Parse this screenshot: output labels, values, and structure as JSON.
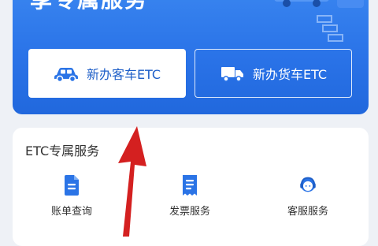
{
  "banner": {
    "title": "享专属服务",
    "buttons": {
      "car_label": "新办客车ETC",
      "truck_label": "新办货车ETC"
    }
  },
  "services": {
    "title": "ETC专属服务",
    "items": [
      {
        "label": "账单查询",
        "icon": "bill-document-icon"
      },
      {
        "label": "发票服务",
        "icon": "invoice-receipt-icon"
      },
      {
        "label": "客服服务",
        "icon": "customer-service-icon"
      }
    ]
  },
  "colors": {
    "banner_blue": "#2a73e8",
    "icon_blue": "#2b74e6",
    "arrow_red": "#d42020",
    "card_bg": "#ffffff",
    "page_bg": "#eef1f6"
  }
}
